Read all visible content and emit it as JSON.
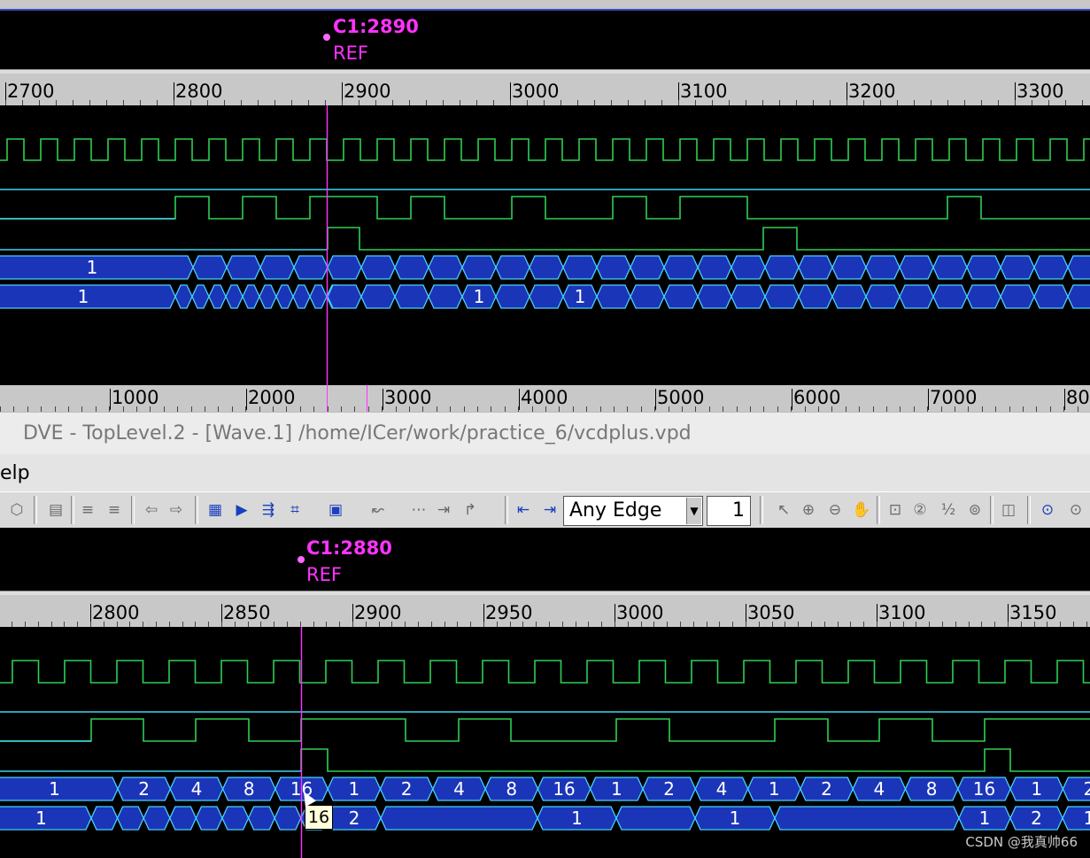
{
  "top_pane": {
    "cursor": {
      "label": "C1:2890",
      "ref": "REF",
      "time": 2890
    },
    "ruler": {
      "labels": [
        "2700",
        "2800",
        "2900",
        "3000",
        "3100",
        "3200",
        "3300"
      ]
    },
    "view_start": 2683,
    "view_end": 3330,
    "clock": {
      "start": 2683,
      "phase": 5,
      "period": 20
    },
    "sig2_edges": [
      2683,
      2790,
      2810,
      2810,
      2830,
      2830,
      2850,
      2850,
      2870,
      2970,
      2990,
      3030,
      3050,
      3090,
      3110,
      3130,
      3152,
      3300,
      3320
    ],
    "sig2_init": 0,
    "sig3_pulses": [
      [
        2890,
        2910
      ],
      [
        3150,
        3170
      ]
    ],
    "bus1": {
      "first_label": "1",
      "first_end": 2790,
      "seg_width": 20
    },
    "bus2": {
      "first_label": "1",
      "first_end": 2790,
      "seg_width": 20,
      "labels": {
        "3: 2980": "1",
        "3: 3040": "1"
      }
    }
  },
  "overview": {
    "labels": [
      "1000",
      "2000",
      "3000",
      "4000",
      "5000",
      "6000",
      "7000",
      "80"
    ],
    "thumb_time": 2890,
    "cursor_time": 2370
  },
  "window": {
    "title": "DVE - TopLevel.2 - [Wave.1]  /home/ICer/work/practice_6/vcdplus.vpd",
    "menu_visible": "elp"
  },
  "toolbar": {
    "edge_select_value": "Any Edge",
    "step_value": "1",
    "icons": [
      "bus-icon",
      "save-icon",
      "layer-up-icon",
      "layer-down-icon",
      "back-arrow-icon",
      "forward-arrow-icon",
      "list-view-icon",
      "signal-icon",
      "trace-driver-icon",
      "schematic-icon",
      "window-icon",
      "group-icon",
      "path-icon",
      "expand-icon",
      "connect-icon",
      "prev-edge-icon",
      "next-edge-icon",
      "pointer-icon",
      "zoom-in-icon",
      "zoom-out-icon",
      "pan-icon",
      "zoom-fit-icon",
      "zoom-2-icon",
      "zoom-half-icon",
      "zoom-full-icon",
      "marker-icon",
      "go-back-icon",
      "go-fwd-icon"
    ]
  },
  "bottom_pane": {
    "cursor": {
      "label": "C1:2880",
      "ref": "REF",
      "time": 2870
    },
    "ruler": {
      "labels": [
        "2800",
        "2850",
        "2900",
        "2950",
        "3000",
        "3050",
        "3100",
        "3150"
      ]
    },
    "bus1_labels": [
      "1",
      "2",
      "4",
      "8",
      "16",
      "1",
      "2",
      "4",
      "8",
      "16",
      "1",
      "2",
      "4",
      "1",
      "2",
      "4",
      "8",
      "16",
      "1",
      "2"
    ],
    "bus2_labels": [
      "1",
      "2",
      "1",
      "1",
      "1",
      "2",
      "1"
    ],
    "tooltip": "16"
  },
  "colors": {
    "background": "#000000",
    "clock": "#2ecf52",
    "trace": "#3ed6f0",
    "bus_fill": "#1b35b8",
    "bus_edge": "#47d0ff",
    "cursor": "#ff33ff",
    "ruler": "#c8c8c8"
  },
  "watermark": "CSDN @我真帅66"
}
